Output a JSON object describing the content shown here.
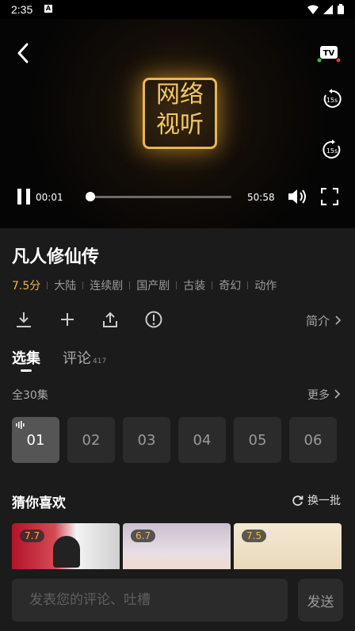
{
  "status": {
    "time": "2:35",
    "a_icon": "A"
  },
  "player": {
    "logo_text": "网络视听",
    "tv_label": "TV",
    "rewind_label": "15s",
    "forward_label": "15s",
    "current_time": "00:01",
    "duration": "50:58",
    "progress_fraction": 0.0003
  },
  "show": {
    "title": "凡人修仙传",
    "score": "7.5分",
    "tags": [
      "大陆",
      "连续剧",
      "国产剧",
      "古装",
      "奇幻",
      "动作"
    ],
    "intro_label": "简介"
  },
  "tabs": {
    "episodes_label": "选集",
    "comments_label": "评论",
    "comments_count": "417"
  },
  "episodes": {
    "total_label": "全30集",
    "more_label": "更多",
    "items": [
      "01",
      "02",
      "03",
      "04",
      "05",
      "06"
    ],
    "active_index": 0
  },
  "recommend": {
    "title": "猜你喜欢",
    "refresh_label": "换一批",
    "items": [
      {
        "score": "7.7"
      },
      {
        "score": "6.7"
      },
      {
        "score": "7.5"
      }
    ]
  },
  "comment_bar": {
    "placeholder": "发表您的评论、吐槽",
    "send_label": "发送"
  },
  "colors": {
    "accent": "#f5b83c",
    "background": "#1b1b1b"
  }
}
